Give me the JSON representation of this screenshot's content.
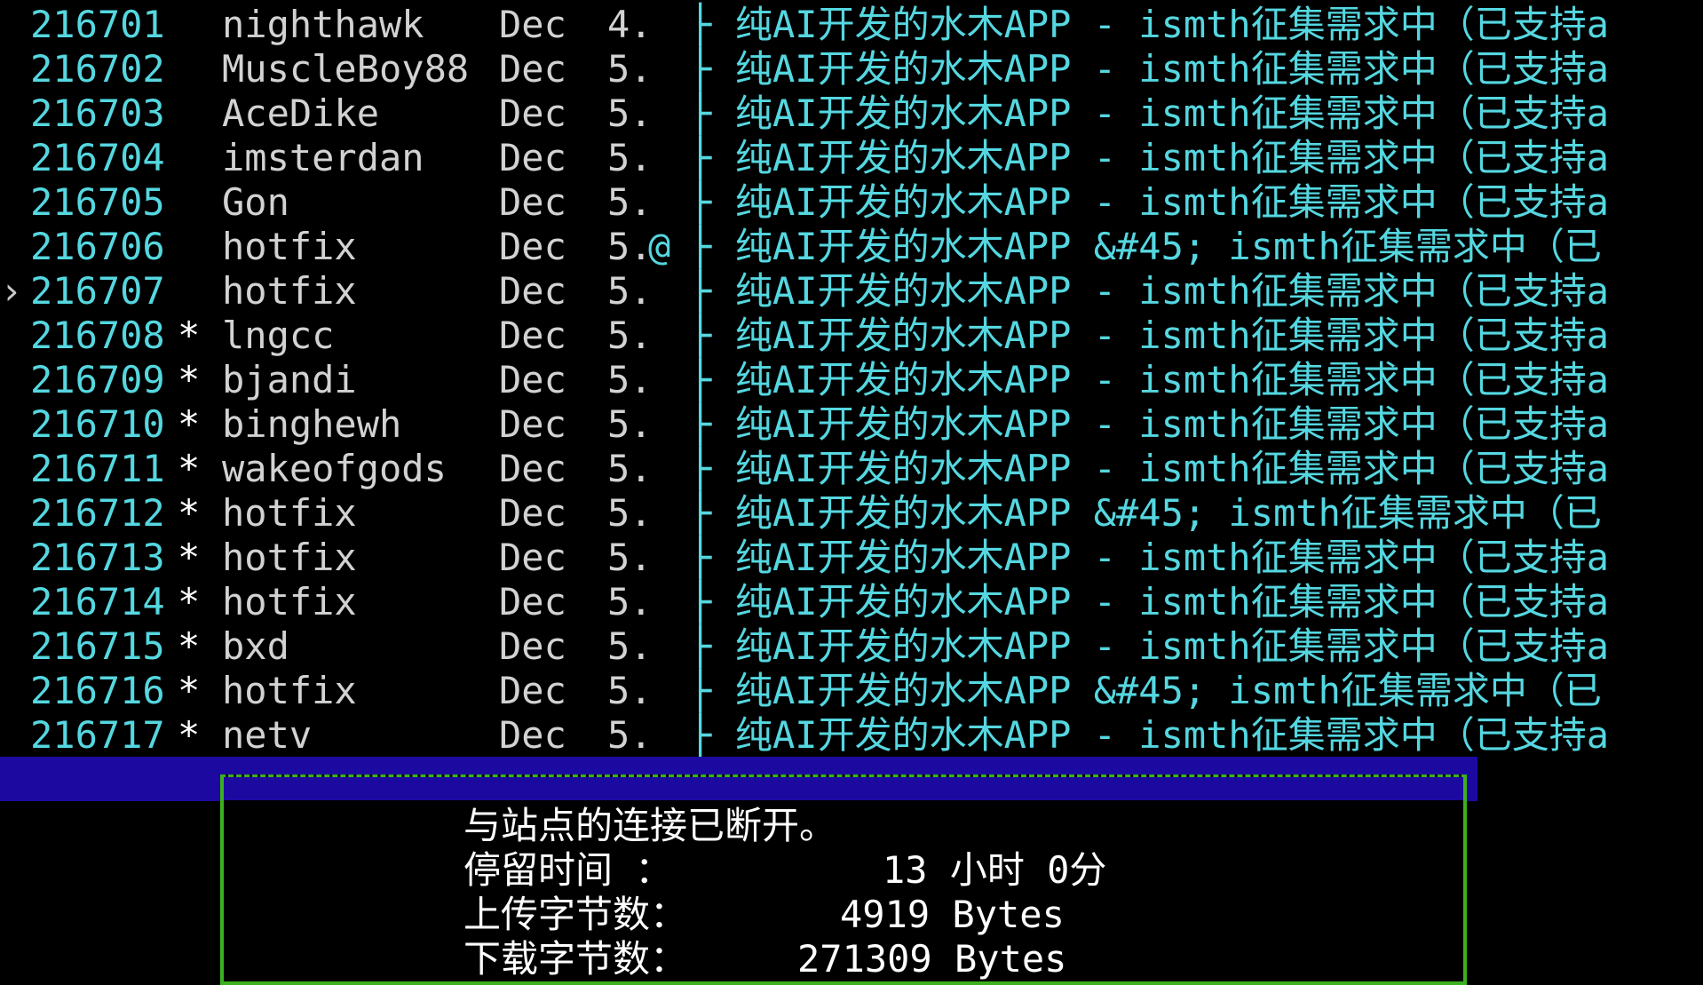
{
  "articles": [
    {
      "number": "216701",
      "mark": "",
      "author": "nighthawk",
      "month": "Dec",
      "day": "4.",
      "flag": "",
      "tree": "├",
      "title": "纯AI开发的水木APP - ismth征集需求中（已支持a",
      "cursor": ""
    },
    {
      "number": "216702",
      "mark": "",
      "author": "MuscleBoy88",
      "month": "Dec",
      "day": "5.",
      "flag": "",
      "tree": "├",
      "title": "纯AI开发的水木APP - ismth征集需求中（已支持a",
      "cursor": ""
    },
    {
      "number": "216703",
      "mark": "",
      "author": "AceDike",
      "month": "Dec",
      "day": "5.",
      "flag": "",
      "tree": "├",
      "title": "纯AI开发的水木APP - ismth征集需求中（已支持a",
      "cursor": ""
    },
    {
      "number": "216704",
      "mark": "",
      "author": "imsterdan",
      "month": "Dec",
      "day": "5.",
      "flag": "",
      "tree": "├",
      "title": "纯AI开发的水木APP - ismth征集需求中（已支持a",
      "cursor": ""
    },
    {
      "number": "216705",
      "mark": "",
      "author": "Gon",
      "month": "Dec",
      "day": "5.",
      "flag": "",
      "tree": "├",
      "title": "纯AI开发的水木APP - ismth征集需求中（已支持a",
      "cursor": ""
    },
    {
      "number": "216706",
      "mark": "",
      "author": "hotfix",
      "month": "Dec",
      "day": "5.",
      "flag": "@",
      "tree": "├",
      "title": "纯AI开发的水木APP &#45; ismth征集需求中（已",
      "cursor": ""
    },
    {
      "number": "216707",
      "mark": "",
      "author": "hotfix",
      "month": "Dec",
      "day": "5.",
      "flag": "",
      "tree": "├",
      "title": "纯AI开发的水木APP - ismth征集需求中（已支持a",
      "cursor": "›"
    },
    {
      "number": "216708",
      "mark": "*",
      "author": "lngcc",
      "month": "Dec",
      "day": "5.",
      "flag": "",
      "tree": "├",
      "title": "纯AI开发的水木APP - ismth征集需求中（已支持a",
      "cursor": ""
    },
    {
      "number": "216709",
      "mark": "*",
      "author": "bjandi",
      "month": "Dec",
      "day": "5.",
      "flag": "",
      "tree": "├",
      "title": "纯AI开发的水木APP - ismth征集需求中（已支持a",
      "cursor": ""
    },
    {
      "number": "216710",
      "mark": "*",
      "author": "binghewh",
      "month": "Dec",
      "day": "5.",
      "flag": "",
      "tree": "├",
      "title": "纯AI开发的水木APP - ismth征集需求中（已支持a",
      "cursor": ""
    },
    {
      "number": "216711",
      "mark": "*",
      "author": "wakeofgods",
      "month": "Dec",
      "day": "5.",
      "flag": "",
      "tree": "├",
      "title": "纯AI开发的水木APP - ismth征集需求中（已支持a",
      "cursor": ""
    },
    {
      "number": "216712",
      "mark": "*",
      "author": "hotfix",
      "month": "Dec",
      "day": "5.",
      "flag": "",
      "tree": "├",
      "title": "纯AI开发的水木APP &#45; ismth征集需求中（已",
      "cursor": ""
    },
    {
      "number": "216713",
      "mark": "*",
      "author": "hotfix",
      "month": "Dec",
      "day": "5.",
      "flag": "",
      "tree": "├",
      "title": "纯AI开发的水木APP - ismth征集需求中（已支持a",
      "cursor": ""
    },
    {
      "number": "216714",
      "mark": "*",
      "author": "hotfix",
      "month": "Dec",
      "day": "5.",
      "flag": "",
      "tree": "├",
      "title": "纯AI开发的水木APP - ismth征集需求中（已支持a",
      "cursor": ""
    },
    {
      "number": "216715",
      "mark": "*",
      "author": "bxd",
      "month": "Dec",
      "day": "5.",
      "flag": "",
      "tree": "├",
      "title": "纯AI开发的水木APP - ismth征集需求中（已支持a",
      "cursor": ""
    },
    {
      "number": "216716",
      "mark": "*",
      "author": "hotfix",
      "month": "Dec",
      "day": "5.",
      "flag": "",
      "tree": "├",
      "title": "纯AI开发的水木APP &#45; ismth征集需求中（已",
      "cursor": ""
    },
    {
      "number": "216717",
      "mark": "*",
      "author": "netv",
      "month": "Dec",
      "day": "5.",
      "flag": "",
      "tree": "├",
      "title": "纯AI开发的水木APP - ismth征集需求中（已支持a",
      "cursor": ""
    }
  ],
  "dialog": {
    "message": "与站点的连接已断开。",
    "stay_label": "停留时间  ：",
    "stay_value": "13 小时 0分",
    "upload_label": "上传字节数：",
    "upload_value": "4919 Bytes",
    "download_label": "下载字节数：",
    "download_value": "271309 Bytes"
  },
  "colors": {
    "background": "#000000",
    "number_text": "#55d7e0",
    "title_text": "#55d7e0",
    "author_text": "#d2d2d2",
    "status_bar": "#1c0aa0",
    "dialog_border": "#3cb020",
    "dialog_text": "#ffffff"
  }
}
